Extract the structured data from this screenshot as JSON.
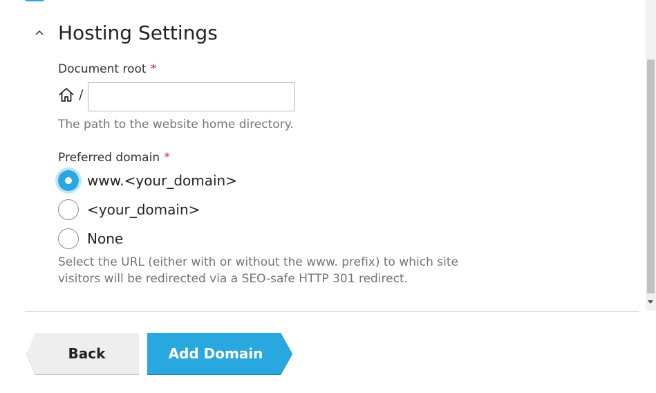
{
  "section": {
    "title": "Hosting Settings",
    "collapse_icon": "chevron-up-icon"
  },
  "document_root": {
    "label": "Document root",
    "required_mark": "*",
    "prefix_icon": "home-icon",
    "prefix_separator": "/",
    "value": "",
    "placeholder": "",
    "hint": "The path to the website home directory."
  },
  "preferred_domain": {
    "label": "Preferred domain",
    "required_mark": "*",
    "options": [
      {
        "label": "www.<your_domain>",
        "checked": true
      },
      {
        "label": "<your_domain>",
        "checked": false
      },
      {
        "label": "None",
        "checked": false
      }
    ],
    "hint_line1": "Select the URL (either with or without the www. prefix) to which site",
    "hint_line2": "visitors will be redirected via a SEO-safe HTTP 301 redirect."
  },
  "buttons": {
    "back_label": "Back",
    "add_domain_label": "Add Domain"
  },
  "colors": {
    "accent": "#28a8de",
    "required": "#d02b52",
    "hint_text": "#737373",
    "back_button_bg": "#eeeeee"
  }
}
